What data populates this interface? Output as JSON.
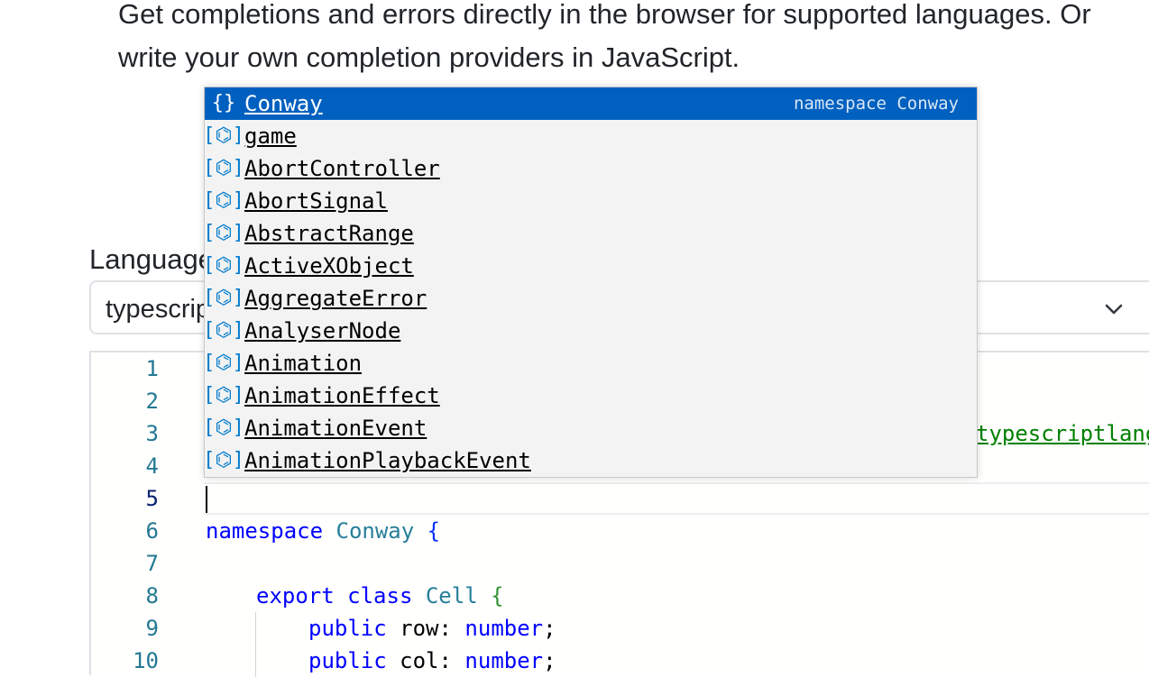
{
  "intro": {
    "text": "Get completions and errors directly in the browser for supported languages. Or write your own completion providers in JavaScript."
  },
  "language": {
    "label": "Language",
    "selected": "typescript"
  },
  "editor": {
    "line_numbers": [
      "1",
      "2",
      "3",
      "4",
      "5",
      "6",
      "7",
      "8",
      "9",
      "10"
    ],
    "active_line": 5,
    "visible_code": {
      "line3_tail": "typescriptlang",
      "line6": {
        "keyword": "namespace",
        "name": "Conway",
        "brace": "{"
      },
      "line8": {
        "keyword1": "export",
        "keyword2": "class",
        "name": "Cell",
        "brace": "{"
      },
      "line9": {
        "keyword": "public",
        "field": "row",
        "colon": ":",
        "type": "number",
        "end": ";"
      },
      "line10": {
        "keyword": "public",
        "field": "col",
        "colon": ":",
        "type": "number",
        "end": ";"
      }
    }
  },
  "suggest": {
    "selected_detail": "namespace Conway",
    "items": [
      {
        "label": "Conway",
        "icon": "namespace-icon",
        "glyph": "{}"
      },
      {
        "label": "game",
        "icon": "variable-icon",
        "glyph": "[⌬]"
      },
      {
        "label": "AbortController",
        "icon": "variable-icon",
        "glyph": "[⌬]"
      },
      {
        "label": "AbortSignal",
        "icon": "variable-icon",
        "glyph": "[⌬]"
      },
      {
        "label": "AbstractRange",
        "icon": "variable-icon",
        "glyph": "[⌬]"
      },
      {
        "label": "ActiveXObject",
        "icon": "variable-icon",
        "glyph": "[⌬]"
      },
      {
        "label": "AggregateError",
        "icon": "variable-icon",
        "glyph": "[⌬]"
      },
      {
        "label": "AnalyserNode",
        "icon": "variable-icon",
        "glyph": "[⌬]"
      },
      {
        "label": "Animation",
        "icon": "variable-icon",
        "glyph": "[⌬]"
      },
      {
        "label": "AnimationEffect",
        "icon": "variable-icon",
        "glyph": "[⌬]"
      },
      {
        "label": "AnimationEvent",
        "icon": "variable-icon",
        "glyph": "[⌬]"
      },
      {
        "label": "AnimationPlaybackEvent",
        "icon": "variable-icon",
        "glyph": "[⌬]"
      }
    ]
  },
  "colors": {
    "selection": "#0060c0",
    "line_number": "#237893",
    "keyword": "#0000ff",
    "type": "#267f99",
    "comment_link": "#008000"
  }
}
